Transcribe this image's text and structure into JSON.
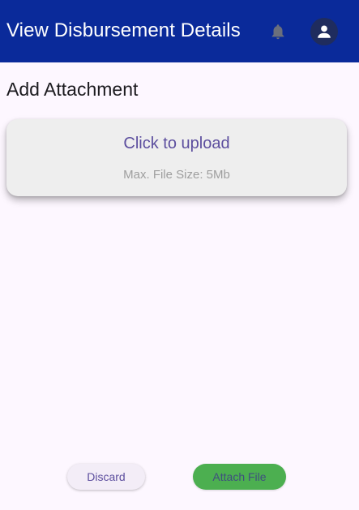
{
  "header": {
    "title": "View Disbursement Details",
    "bell_icon": "bell-icon",
    "avatar_icon": "account-circle-icon",
    "background": "#0a2a9a"
  },
  "main": {
    "section_title": "Add Attachment",
    "upload": {
      "label": "Click to upload",
      "hint": "Max. File Size: 5Mb"
    }
  },
  "footer": {
    "discard_label": "Discard",
    "attach_label": "Attach File",
    "attach_color": "#4caf50"
  }
}
